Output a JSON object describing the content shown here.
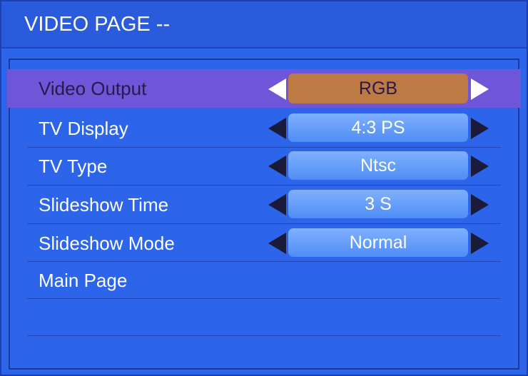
{
  "title": "VIDEO PAGE --",
  "menu": {
    "items": [
      {
        "label": "Video Output",
        "value": "RGB",
        "selected": true
      },
      {
        "label": "TV Display",
        "value": "4:3 PS"
      },
      {
        "label": "TV Type",
        "value": "Ntsc"
      },
      {
        "label": "Slideshow Time",
        "value": "3 S"
      },
      {
        "label": "Slideshow Mode",
        "value": "Normal"
      },
      {
        "label": "Main Page"
      }
    ]
  },
  "icons": {
    "left": "triangle-left-icon",
    "right": "triangle-right-icon"
  },
  "colors": {
    "background": "#2c64ea",
    "selected_row": "#6f55d8",
    "selected_value": "#bd7a45",
    "value_box": "#5f9af8"
  }
}
